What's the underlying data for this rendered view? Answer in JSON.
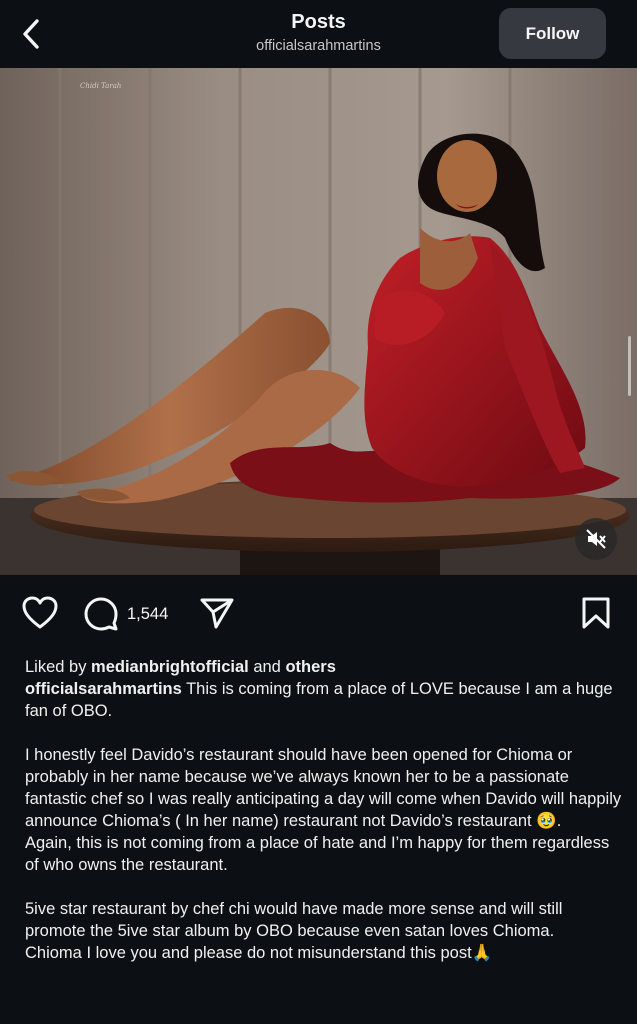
{
  "header": {
    "title": "Posts",
    "username": "officialsarahmartins",
    "follow_label": "Follow"
  },
  "photo": {
    "watermark": "Chidi Tarah",
    "mute_icon": "muted-speaker-icon"
  },
  "actions": {
    "like_icon": "heart-icon",
    "comment_icon": "comment-icon",
    "comment_count": "1,544",
    "share_icon": "send-icon",
    "save_icon": "bookmark-icon"
  },
  "caption": {
    "liked_prefix": "Liked by ",
    "liked_user": "medianbrightofficial",
    "liked_and": " and ",
    "liked_others": "others",
    "author": "officialsarahmartins",
    "line1": " This is coming from a place of LOVE because I am a huge fan of OBO.",
    "para2": "I honestly feel Davido’s restaurant should have been opened for Chioma or probably in her name because we’ve always known her to be a passionate fantastic chef so I was really anticipating a day will come when Davido will happily announce Chioma’s ( In her name) restaurant not Davido’s restaurant ",
    "para2_emoji": "🥹",
    "para2_end": ".",
    "para3": "Again, this is not coming from a place of hate and I’m happy for them regardless of who owns the restaurant.",
    "para4": "5ive star restaurant by chef chi would have made more sense and will still promote the 5ive star album by OBO because even satan loves Chioma.",
    "para5": "Chioma I love you and please do not misunderstand this post",
    "para5_emoji": "🙏"
  },
  "colors": {
    "background": "#0c1014",
    "follow_button": "#363a40",
    "dress": "#a3141d"
  }
}
